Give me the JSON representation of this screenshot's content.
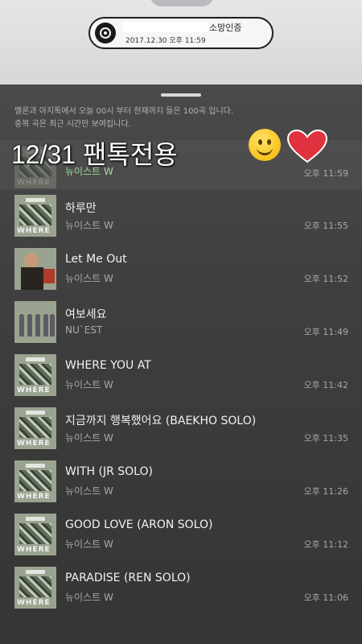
{
  "certificate": {
    "title": "소망인증",
    "date": "2017.12.30 오후 11:59"
  },
  "notice": {
    "line1": "멜론과 아지톡에서 오늘 00시 부터 현재까지 들은 100곡 입니다.",
    "line2": "중복 곡은 최근 시간만 보여집니다."
  },
  "overlay_text": "12/31 팬톡전용",
  "songs": [
    {
      "title": "",
      "artist": "뉴이스트 W",
      "time": "오후 11:59"
    },
    {
      "title": "하루만",
      "artist": "뉴이스트 W",
      "time": "오후 11:55"
    },
    {
      "title": "Let Me Out",
      "artist": "뉴이스트 W",
      "time": "오후 11:52"
    },
    {
      "title": "여보세요",
      "artist": "NU`EST",
      "time": "오후 11:49"
    },
    {
      "title": "WHERE YOU AT",
      "artist": "뉴이스트 W",
      "time": "오후 11:42"
    },
    {
      "title": "지금까지 행복했어요 (BAEKHO SOLO)",
      "artist": "뉴이스트 W",
      "time": "오후 11:35"
    },
    {
      "title": "WITH (JR SOLO)",
      "artist": "뉴이스트 W",
      "time": "오후 11:26"
    },
    {
      "title": "GOOD LOVE (ARON SOLO)",
      "artist": "뉴이스트 W",
      "time": "오후 11:12"
    },
    {
      "title": "PARADISE (REN SOLO)",
      "artist": "뉴이스트 W",
      "time": "오후 11:06"
    }
  ],
  "covers": {
    "where_text": "WHERE"
  },
  "colors": {
    "panel": "#3e3e3e",
    "accent_green": "#9be09b",
    "heart": "#e0323f"
  }
}
